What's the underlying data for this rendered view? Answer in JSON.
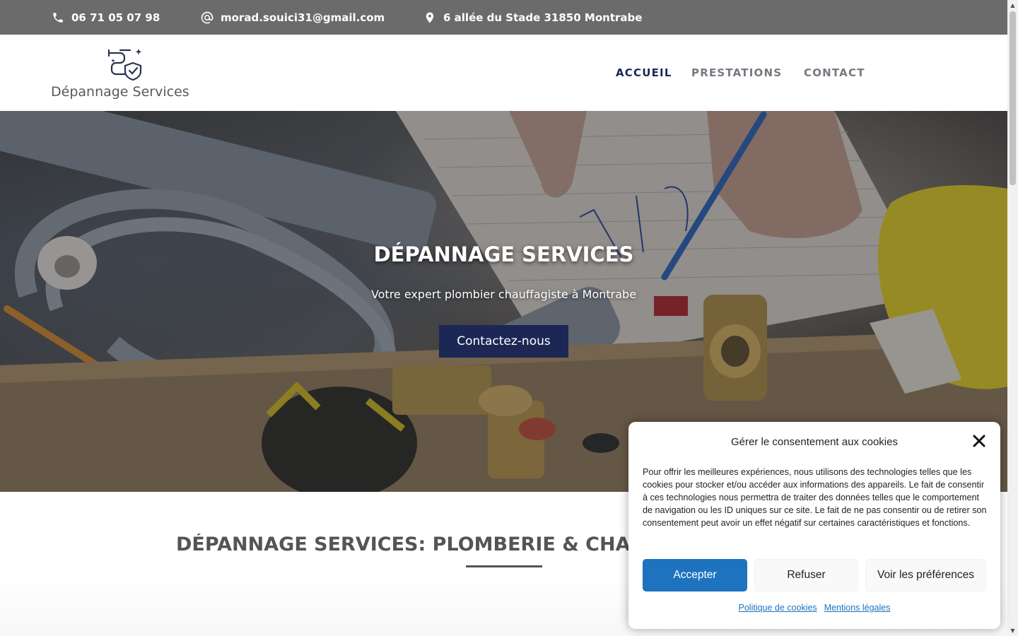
{
  "topbar": {
    "phone": "06 71 05 07 98",
    "email": "morad.souici31@gmail.com",
    "address": "6 allée du Stade 31850 Montrabe",
    "phone_icon": "phone-icon",
    "email_icon": "at-icon",
    "address_icon": "map-pin-icon"
  },
  "header": {
    "logo_text": "Dépannage Services",
    "nav": [
      {
        "label": "ACCUEIL",
        "active": true
      },
      {
        "label": "PRESTATIONS",
        "active": false
      },
      {
        "label": "CONTACT",
        "active": false
      }
    ]
  },
  "hero": {
    "title": "DÉPANNAGE SERVICES",
    "subtitle": "Votre expert plombier chauffagiste à Montrabe",
    "cta_label": "Contactez-nous"
  },
  "section": {
    "title": "DÉPANNAGE SERVICES: PLOMBERIE & CHAUFFAGE"
  },
  "cookie": {
    "title": "Gérer le consentement aux cookies",
    "body": "Pour offrir les meilleures expériences, nous utilisons des technologies telles que les cookies pour stocker et/ou accéder aux informations des appareils. Le fait de consentir à ces technologies nous permettra de traiter des données telles que le comportement de navigation ou les ID uniques sur ce site. Le fait de ne pas consentir ou de retirer son consentement peut avoir un effet négatif sur certaines caractéristiques et fonctions.",
    "accept_label": "Accepter",
    "refuse_label": "Refuser",
    "prefs_label": "Voir les préférences",
    "link_policy": "Politique de cookies",
    "link_legal": "Mentions légales"
  },
  "colors": {
    "topbar": "#6b6b6b",
    "brand_navy": "#1c2756",
    "accept_blue": "#1e73be"
  }
}
